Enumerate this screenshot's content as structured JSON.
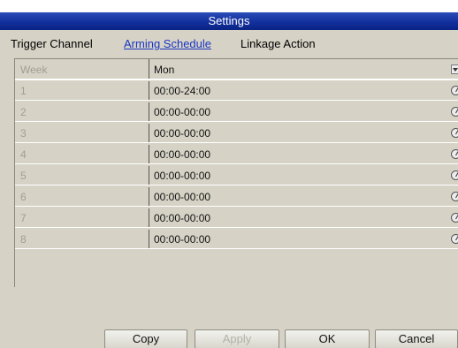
{
  "window": {
    "title": "Settings"
  },
  "tabs": [
    {
      "label": "Trigger Channel",
      "active": false
    },
    {
      "label": "Arming Schedule",
      "active": true
    },
    {
      "label": "Linkage Action",
      "active": false
    }
  ],
  "schedule": {
    "header": {
      "label": "Week",
      "value": "Mon",
      "icon": "dropdown-arrow-icon"
    },
    "rows": [
      {
        "label": "1",
        "time": "00:00-24:00",
        "icon": "clock-icon"
      },
      {
        "label": "2",
        "time": "00:00-00:00",
        "icon": "clock-icon"
      },
      {
        "label": "3",
        "time": "00:00-00:00",
        "icon": "clock-icon"
      },
      {
        "label": "4",
        "time": "00:00-00:00",
        "icon": "clock-icon"
      },
      {
        "label": "5",
        "time": "00:00-00:00",
        "icon": "clock-icon"
      },
      {
        "label": "6",
        "time": "00:00-00:00",
        "icon": "clock-icon"
      },
      {
        "label": "7",
        "time": "00:00-00:00",
        "icon": "clock-icon"
      },
      {
        "label": "8",
        "time": "00:00-00:00",
        "icon": "clock-icon"
      }
    ]
  },
  "buttons": {
    "copy": "Copy",
    "apply": "Apply",
    "ok": "OK",
    "cancel": "Cancel"
  },
  "colors": {
    "titlebar": "#13309c",
    "panel": "#d6d3c6",
    "active_tab": "#1a34c4",
    "disabled_text": "#b3b1a8"
  }
}
